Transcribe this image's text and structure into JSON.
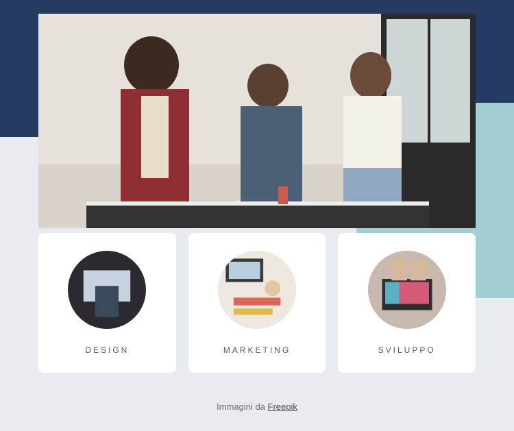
{
  "colors": {
    "navy": "#243a62",
    "teal": "#a3cfd4",
    "card_bg": "#ffffff",
    "page_bg": "#e8ecf0"
  },
  "hero": {
    "alt": "team-collaboration-photo"
  },
  "cards": [
    {
      "title": "DESIGN",
      "icon": "design-thumb"
    },
    {
      "title": "MARKETING",
      "icon": "marketing-thumb"
    },
    {
      "title": "SVILUPPO",
      "icon": "sviluppo-thumb"
    }
  ],
  "caption": {
    "prefix": "Immagini da ",
    "link_text": "Freepik"
  }
}
